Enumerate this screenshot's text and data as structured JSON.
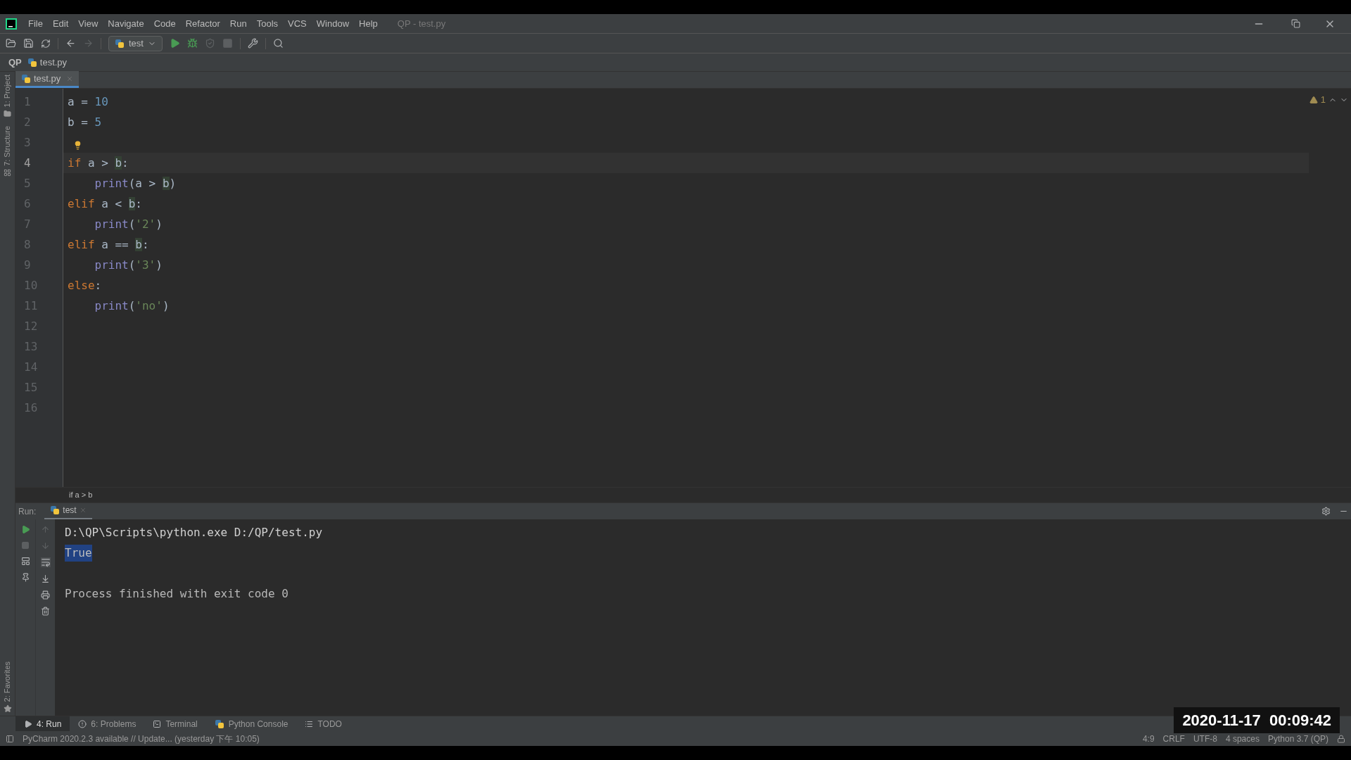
{
  "window": {
    "menu": [
      "File",
      "Edit",
      "View",
      "Navigate",
      "Code",
      "Refactor",
      "Run",
      "Tools",
      "VCS",
      "Window",
      "Help"
    ],
    "title": "QP - test.py"
  },
  "toolbar": {
    "run_config": "test",
    "actions": [
      {
        "kind": "run",
        "disabled": false
      },
      {
        "kind": "debug",
        "disabled": false
      },
      {
        "kind": "coverage",
        "disabled": true
      },
      {
        "kind": "stop",
        "disabled": true
      }
    ]
  },
  "navigation_bar": [
    "QP",
    "test.py"
  ],
  "side_stripe": {
    "top": [
      "1: Project",
      "7: Structure"
    ],
    "bottom": [
      "2: Favorites"
    ]
  },
  "editor": {
    "tabs": [
      {
        "label": "test.py",
        "selected": true
      }
    ],
    "warnings": "1",
    "lines": [
      {
        "number": "1",
        "current": false,
        "indent": false,
        "tokens": [
          {
            "text": "a",
            "kind": "plain"
          },
          {
            "text": " = ",
            "kind": "plain"
          },
          {
            "text": "10",
            "kind": "number"
          }
        ]
      },
      {
        "number": "2",
        "current": false,
        "indent": false,
        "tokens": [
          {
            "text": "b",
            "kind": "plain"
          },
          {
            "text": " = ",
            "kind": "plain"
          },
          {
            "text": "5",
            "kind": "number"
          }
        ]
      },
      {
        "number": "3",
        "current": false,
        "bulb": true
      },
      {
        "number": "4",
        "current": true,
        "indent": false,
        "tokens": [
          {
            "text": "if",
            "kind": "keyword"
          },
          {
            "text": " a > ",
            "kind": "plain"
          },
          {
            "text": "b",
            "kind": "ref"
          },
          {
            "text": ":",
            "kind": "plain"
          }
        ]
      },
      {
        "number": "5",
        "current": false,
        "indent": true,
        "tokens": [
          {
            "text": "print",
            "kind": "builtin"
          },
          {
            "text": "(a > ",
            "kind": "plain"
          },
          {
            "text": "b",
            "kind": "ref"
          },
          {
            "text": ")",
            "kind": "plain"
          }
        ]
      },
      {
        "number": "6",
        "current": false,
        "indent": false,
        "tokens": [
          {
            "text": "elif",
            "kind": "keyword"
          },
          {
            "text": " a < ",
            "kind": "plain"
          },
          {
            "text": "b",
            "kind": "ref"
          },
          {
            "text": ":",
            "kind": "plain"
          }
        ]
      },
      {
        "number": "7",
        "current": false,
        "indent": true,
        "tokens": [
          {
            "text": "print",
            "kind": "builtin"
          },
          {
            "text": "(",
            "kind": "plain"
          },
          {
            "text": "'2'",
            "kind": "string"
          },
          {
            "text": ")",
            "kind": "plain"
          }
        ]
      },
      {
        "number": "8",
        "current": false,
        "indent": false,
        "tokens": [
          {
            "text": "elif",
            "kind": "keyword"
          },
          {
            "text": " a == ",
            "kind": "plain"
          },
          {
            "text": "b",
            "kind": "ref"
          },
          {
            "text": ":",
            "kind": "plain"
          }
        ]
      },
      {
        "number": "9",
        "current": false,
        "indent": true,
        "tokens": [
          {
            "text": "print",
            "kind": "builtin"
          },
          {
            "text": "(",
            "kind": "plain"
          },
          {
            "text": "'3'",
            "kind": "string"
          },
          {
            "text": ")",
            "kind": "plain"
          }
        ]
      },
      {
        "number": "10",
        "current": false,
        "indent": false,
        "tokens": [
          {
            "text": "else",
            "kind": "keyword"
          },
          {
            "text": ":",
            "kind": "plain"
          }
        ]
      },
      {
        "number": "11",
        "current": false,
        "indent": true,
        "tokens": [
          {
            "text": "print",
            "kind": "builtin"
          },
          {
            "text": "(",
            "kind": "plain"
          },
          {
            "text": "'no'",
            "kind": "string"
          },
          {
            "text": ")",
            "kind": "plain"
          }
        ]
      },
      {
        "number": "12",
        "current": false
      },
      {
        "number": "13",
        "current": false
      },
      {
        "number": "14",
        "current": false
      },
      {
        "number": "15",
        "current": false
      },
      {
        "number": "16",
        "current": false
      }
    ],
    "breadcrumb": "if a > b"
  },
  "run_panel": {
    "label": "Run:",
    "tabs": [
      {
        "label": "test",
        "selected": true
      }
    ],
    "console": [
      {
        "kind": "command",
        "text": "D:\\QP\\Scripts\\python.exe D:/QP/test.py",
        "selected": false
      },
      {
        "kind": "output",
        "text": "True",
        "selected": true
      },
      {
        "kind": "blank"
      },
      {
        "kind": "info",
        "text": "Process finished with exit code 0",
        "selected": false
      }
    ]
  },
  "tool_tabs": [
    {
      "kind": "run",
      "label": "4: Run",
      "selected": true
    },
    {
      "kind": "problems",
      "label": "6: Problems",
      "selected": false
    },
    {
      "kind": "terminal",
      "label": "Terminal",
      "selected": false
    },
    {
      "kind": "console",
      "label": "Python Console",
      "selected": false
    },
    {
      "kind": "todo",
      "label": "TODO",
      "selected": false
    }
  ],
  "status_bar": {
    "message": "PyCharm 2020.2.3 available // Update... (yesterday 下午 10:05)",
    "fields": [
      "4:9",
      "CRLF",
      "UTF-8",
      "4 spaces",
      "Python 3.7 (QP)"
    ]
  },
  "timestamp_overlay": "2020-11-17  00:09:42"
}
